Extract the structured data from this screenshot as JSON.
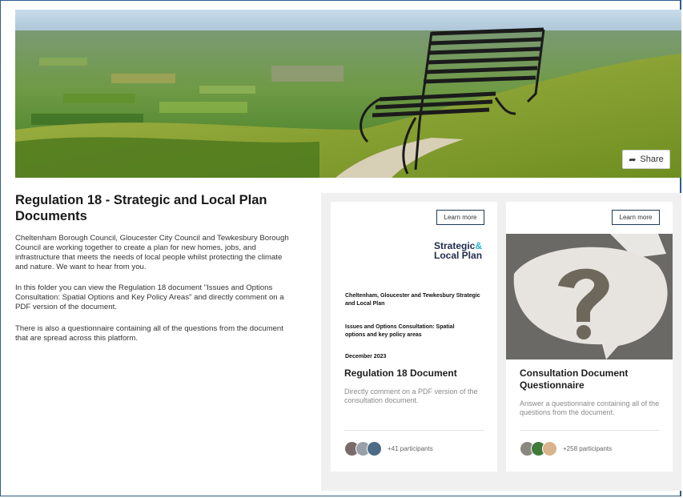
{
  "hero": {
    "share_label": "Share",
    "share_icon": "share-arrow-icon"
  },
  "main": {
    "title": "Regulation 18 - Strategic and Local Plan Documents",
    "paragraphs": [
      "Cheltenham Borough Council, Gloucester City Council and Tewkesbury Borough Council are working together to create a plan for new homes, jobs, and infrastructure that meets the needs of local people whilst protecting the climate and nature. We want to hear from you.",
      "In this folder you can view the Regulation 18 document \"Issues and Options Consultation: Spatial Options and Key Policy Areas\" and directly comment on a PDF version of the document.",
      "There is also a questionnaire containing all of the questions from the document that are spread across this platform."
    ]
  },
  "cards": [
    {
      "learn_more": "Learn more",
      "thumbnail": {
        "logo_line1": "Strategic",
        "logo_amp": "&",
        "logo_line2": "Local Plan",
        "doc_title": "Cheltenham, Gloucester and Tewkesbury Strategic and Local Plan",
        "doc_subtitle": "Issues and Options Consultation: Spatial options and key policy areas",
        "doc_date": "December 2023"
      },
      "title": "Regulation 18 Document",
      "description": "Directly comment on a PDF version of the consultation document.",
      "participants": "+41 participants"
    },
    {
      "learn_more": "Learn more",
      "title": "Consultation Document Questionnaire",
      "description": "Answer a questionnaire containing all of the questions from the document.",
      "participants": "+258 participants"
    }
  ]
}
